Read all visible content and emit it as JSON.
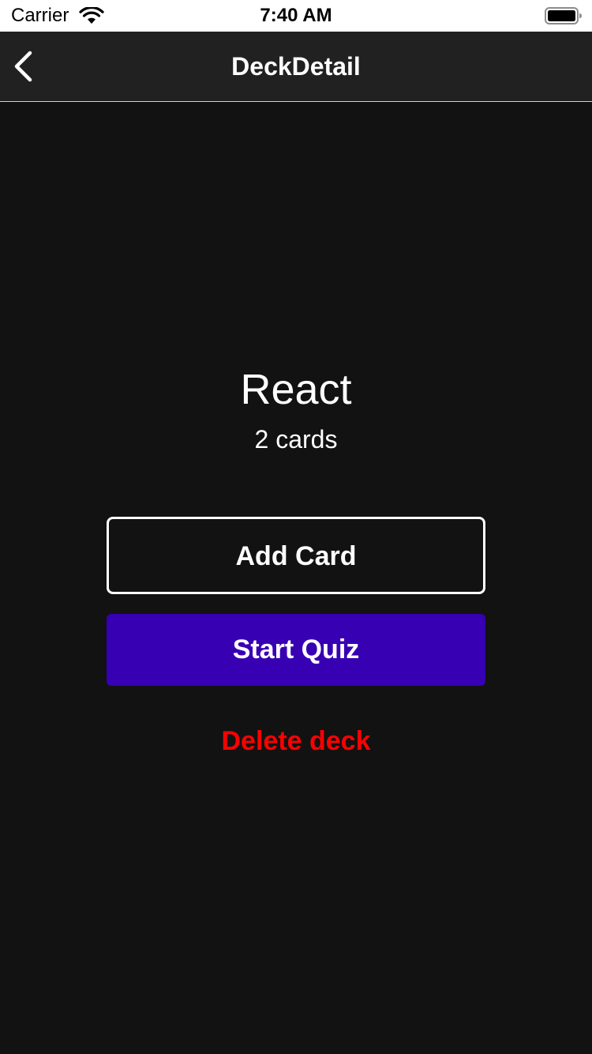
{
  "status_bar": {
    "carrier": "Carrier",
    "time": "7:40 AM",
    "wifi_icon": "wifi-icon",
    "battery_icon": "battery-icon"
  },
  "nav": {
    "title": "DeckDetail",
    "back_icon": "chevron-left-icon"
  },
  "deck": {
    "title": "React",
    "count": "2 cards"
  },
  "actions": {
    "add_card_label": "Add Card",
    "start_quiz_label": "Start Quiz",
    "delete_label": "Delete deck"
  },
  "colors": {
    "background": "#121212",
    "nav_background": "#212121",
    "accent": "#3700b3",
    "danger": "#ff0000"
  }
}
